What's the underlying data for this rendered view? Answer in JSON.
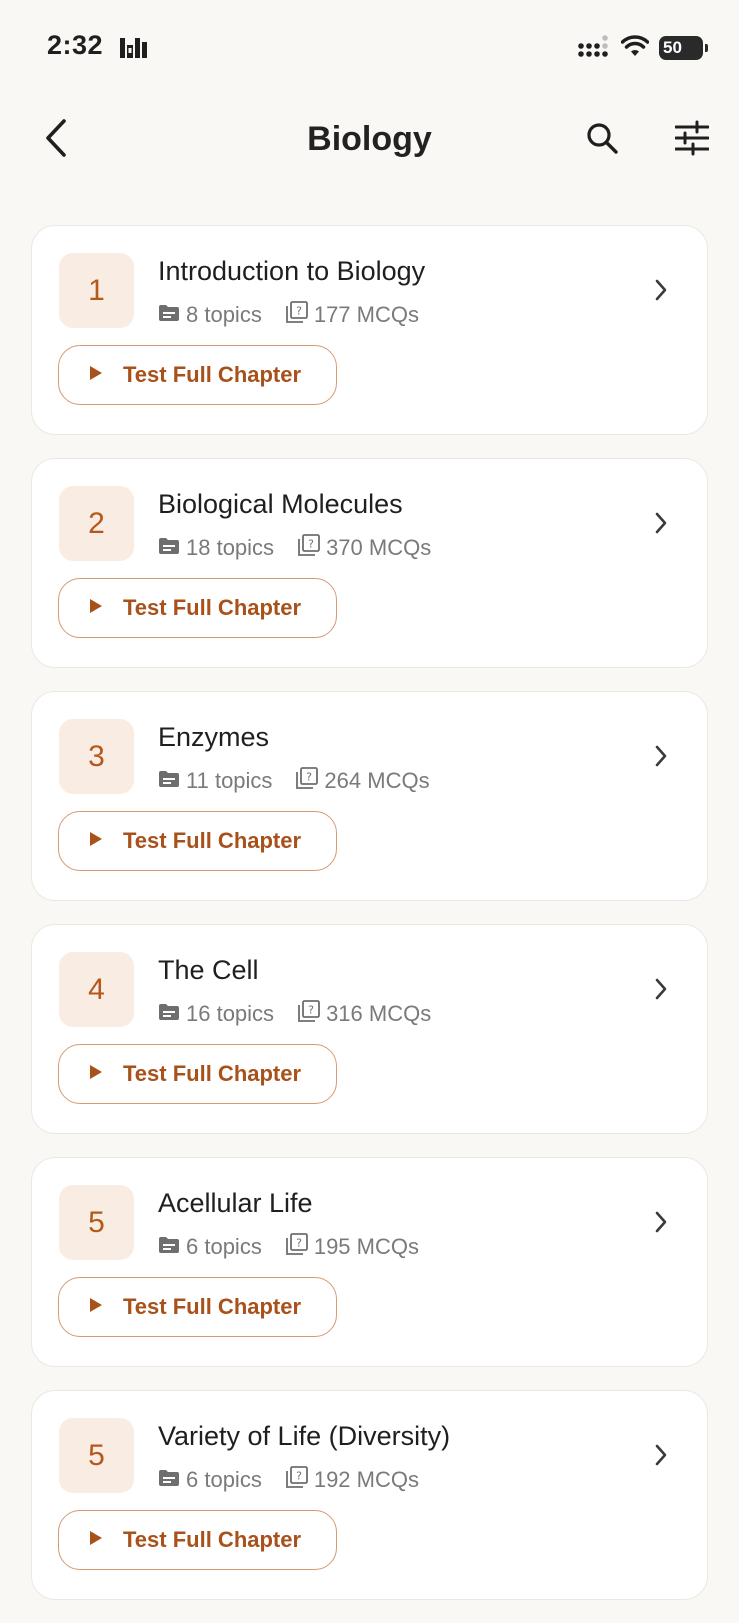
{
  "status_bar": {
    "time": "2:32",
    "battery": "50"
  },
  "header": {
    "title": "Biology",
    "back_icon": "chevron-left-icon",
    "search_icon": "search-icon",
    "filter_icon": "sliders-icon"
  },
  "colors": {
    "accent": "#b5581b",
    "badge_bg": "#f8ece3",
    "button_border": "#d69a74",
    "background": "#faf8f5"
  },
  "chapters": [
    {
      "number": "1",
      "title": "Introduction to Biology",
      "topics": "8 topics",
      "mcqs": "177 MCQs",
      "action": "Test Full Chapter"
    },
    {
      "number": "2",
      "title": "Biological Molecules",
      "topics": "18 topics",
      "mcqs": "370 MCQs",
      "action": "Test Full Chapter"
    },
    {
      "number": "3",
      "title": "Enzymes",
      "topics": "11 topics",
      "mcqs": "264 MCQs",
      "action": "Test Full Chapter"
    },
    {
      "number": "4",
      "title": "The Cell",
      "topics": "16 topics",
      "mcqs": "316 MCQs",
      "action": "Test Full Chapter"
    },
    {
      "number": "5",
      "title": "Acellular Life",
      "topics": "6 topics",
      "mcqs": "195 MCQs",
      "action": "Test Full Chapter"
    },
    {
      "number": "5",
      "title": "Variety of Life (Diversity)",
      "topics": "6 topics",
      "mcqs": "192 MCQs",
      "action": "Test Full Chapter"
    }
  ]
}
